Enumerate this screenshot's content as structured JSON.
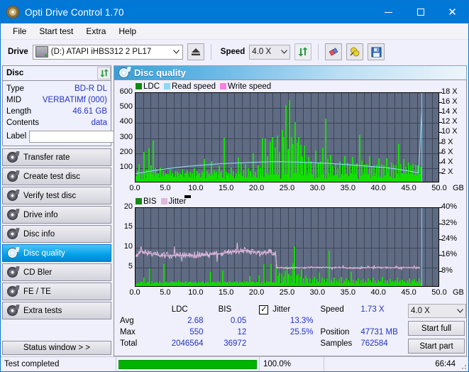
{
  "window": {
    "title": "Opti Drive Control 1.70",
    "icon": "disc-icon",
    "minimize": "—",
    "maximize": "□",
    "close": "✕"
  },
  "menu": {
    "items": [
      "File",
      "Start test",
      "Extra",
      "Help"
    ]
  },
  "toolbar": {
    "drive_label": "Drive",
    "drive_value": "(D:)   ATAPI iHBS312  2 PL17",
    "eject_icon": "eject-icon",
    "speed_label": "Speed",
    "speed_value": "4.0 X",
    "refresh_icon": "refresh-icon",
    "eraser_icon": "eraser-icon",
    "bulb_icon": "bulb-icon",
    "save_icon": "save-icon",
    "caret": "∨"
  },
  "sidebar": {
    "disc_panel": {
      "title": "Disc",
      "refresh_icon": "refresh-icon",
      "rows": [
        {
          "key": "Type",
          "value": "BD-R DL"
        },
        {
          "key": "MID",
          "value": "VERBATIMf (000)"
        },
        {
          "key": "Length",
          "value": "46.61 GB"
        },
        {
          "key": "Contents",
          "value": "data"
        }
      ],
      "label_key": "Label",
      "label_value": "",
      "label_placeholder": "",
      "label_button_icon": "disc-icon"
    },
    "nav": [
      {
        "label": "Transfer rate",
        "icon": "disc-icon",
        "active": false
      },
      {
        "label": "Create test disc",
        "icon": "disc-icon",
        "active": false
      },
      {
        "label": "Verify test disc",
        "icon": "disc-icon",
        "active": false
      },
      {
        "label": "Drive info",
        "icon": "disc-icon",
        "active": false
      },
      {
        "label": "Disc info",
        "icon": "disc-icon",
        "active": false
      },
      {
        "label": "Disc quality",
        "icon": "disc-icon",
        "active": true
      },
      {
        "label": "CD Bler",
        "icon": "disc-icon",
        "active": false
      },
      {
        "label": "FE / TE",
        "icon": "disc-icon",
        "active": false
      },
      {
        "label": "Extra tests",
        "icon": "disc-icon",
        "active": false
      }
    ],
    "status_window_button": "Status window > >"
  },
  "main": {
    "header": {
      "title": "Disc quality",
      "icon": "disc-icon"
    }
  },
  "stats": {
    "col_headers": [
      "LDC",
      "BIS"
    ],
    "row_headers": [
      "Avg",
      "Max",
      "Total"
    ],
    "ldc": {
      "avg": "2.68",
      "max": "550",
      "total": "2046564"
    },
    "bis": {
      "avg": "0.05",
      "max": "12",
      "total": "36972"
    },
    "jitter": {
      "label": "Jitter",
      "checked": true,
      "check_glyph": "✓",
      "avg": "13.3%",
      "max": "25.5%"
    },
    "speed_label": "Speed",
    "speed_value": "1.73 X",
    "position_label": "Position",
    "position_value": "47731 MB",
    "samples_label": "Samples",
    "samples_value": "762584",
    "speed_select": "4.0 X",
    "start_full_button": "Start full",
    "start_part_button": "Start part"
  },
  "statusbar": {
    "message": "Test completed",
    "percent": "100.0%",
    "elapsed": "66:44",
    "progress_value": 100
  },
  "colors": {
    "accent": "#0078d7",
    "plot_bg": "#5f6b82",
    "ldc_green": "#12e000",
    "read_speed_blue": "#8fd8f5",
    "write_speed_pink": "#f97fe0",
    "bis_green": "#12d900",
    "jitter_pink": "#e2b6de",
    "value_blue": "#2431c7",
    "cursor_cyan": "#62d9f5"
  },
  "chart_data": [
    {
      "type": "bar",
      "name": "quality-chart",
      "title": "",
      "xlabel": "GB",
      "ylabel": "LDC",
      "xlim": [
        0,
        50
      ],
      "ylim": [
        0,
        600
      ],
      "y2lim": [
        0,
        18
      ],
      "y2label": "X",
      "grid": true,
      "legend": [
        {
          "label": "LDC",
          "color": "#108a10"
        },
        {
          "label": "Read speed",
          "color": "#8fd8f5"
        },
        {
          "label": "Write speed",
          "color": "#f97fe0"
        }
      ],
      "xticks": [
        "0.0",
        "5.0",
        "10.0",
        "15.0",
        "20.0",
        "25.0",
        "30.0",
        "35.0",
        "40.0",
        "45.0",
        "50.0"
      ],
      "yticks": [
        100,
        200,
        300,
        400,
        500,
        600
      ],
      "y2ticks": [
        "2 X",
        "4 X",
        "6 X",
        "8 X",
        "10 X",
        "12 X",
        "14 X",
        "16 X",
        "18 X"
      ],
      "cursor_x": 47.0,
      "series": [
        {
          "name": "LDC",
          "type": "bar",
          "color": "#12e000",
          "x": [
            0.2,
            0.5,
            0.9,
            1.3,
            1.7,
            2.1,
            2.4,
            2.8,
            3.2,
            3.6,
            4.0,
            4.4,
            4.8,
            5.2,
            5.6,
            6.0,
            6.4,
            6.8,
            7.2,
            7.6,
            8.0,
            8.4,
            8.8,
            9.2,
            9.6,
            10.0,
            10.4,
            10.8,
            11.2,
            11.6,
            12.0,
            12.4,
            12.8,
            13.2,
            13.6,
            14.0,
            14.4,
            14.8,
            15.2,
            15.6,
            16.0,
            16.4,
            16.8,
            17.2,
            17.6,
            18.0,
            18.4,
            18.8,
            19.2,
            19.6,
            20.0,
            20.4,
            20.8,
            21.2,
            21.6,
            22.0,
            22.4,
            22.8,
            23.2,
            23.6,
            24.0,
            24.3,
            24.6,
            24.9,
            25.2,
            25.5,
            25.8,
            26.1,
            26.4,
            26.7,
            27.0,
            27.3,
            27.6,
            27.9,
            28.3,
            28.7,
            29.1,
            29.5,
            29.9,
            30.3,
            30.7,
            31.1,
            31.5,
            31.9,
            32.3,
            32.7,
            33.1,
            33.5,
            33.9,
            34.3,
            34.7,
            35.1,
            35.5,
            35.9,
            36.3,
            36.7,
            37.1,
            37.5,
            37.9,
            38.3,
            38.7,
            39.1,
            39.5,
            39.9,
            40.3,
            40.7,
            41.1,
            41.5,
            41.9,
            42.3,
            42.7,
            43.1,
            43.5,
            43.9,
            44.3,
            44.7,
            45.1,
            45.5,
            45.9,
            46.3,
            46.7
          ],
          "y": [
            70,
            120,
            60,
            200,
            80,
            225,
            110,
            275,
            90,
            60,
            95,
            70,
            60,
            55,
            85,
            60,
            70,
            65,
            60,
            85,
            60,
            75,
            65,
            55,
            90,
            70,
            60,
            65,
            150,
            70,
            60,
            140,
            75,
            65,
            110,
            70,
            295,
            65,
            60,
            95,
            70,
            60,
            160,
            130,
            75,
            120,
            90,
            70,
            190,
            65,
            110,
            90,
            290,
            290,
            170,
            265,
            300,
            230,
            310,
            200,
            345,
            300,
            510,
            220,
            545,
            300,
            250,
            400,
            260,
            300,
            245,
            170,
            240,
            135,
            165,
            140,
            120,
            210,
            130,
            140,
            230,
            420,
            150,
            180,
            110,
            125,
            90,
            140,
            115,
            170,
            130,
            120,
            165,
            110,
            125,
            315,
            145,
            115,
            120,
            170,
            100,
            110,
            115,
            155,
            120,
            110,
            155,
            100,
            130,
            115,
            110,
            250,
            120,
            150,
            100,
            130,
            110,
            120,
            115,
            110,
            100
          ]
        },
        {
          "name": "Read speed",
          "type": "line",
          "color": "#8fd8f5",
          "x": [
            0.0,
            2.0,
            4.0,
            6.0,
            8.0,
            10.0,
            12.0,
            14.0,
            16.0,
            18.0,
            20.0,
            22.0,
            23.5,
            25.0,
            27.0,
            29.0,
            31.0,
            33.0,
            35.0,
            37.0,
            39.0,
            41.0,
            43.0,
            45.0,
            46.5,
            47.0
          ],
          "y_x_units": [
            1.9,
            2.3,
            2.7,
            3.0,
            3.3,
            3.5,
            3.7,
            3.9,
            4.0,
            4.1,
            4.2,
            4.25,
            4.3,
            4.25,
            4.2,
            4.1,
            4.0,
            3.85,
            3.7,
            3.5,
            3.3,
            3.1,
            2.8,
            2.4,
            2.05,
            14.0
          ]
        }
      ]
    },
    {
      "type": "bar",
      "name": "bis-jitter-chart",
      "title": "",
      "xlabel": "GB",
      "ylabel": "BIS",
      "xlim": [
        0,
        50
      ],
      "ylim": [
        0,
        20
      ],
      "y2lim": [
        0,
        40
      ],
      "y2label": "%",
      "grid": true,
      "legend": [
        {
          "label": "BIS",
          "color": "#108a10"
        },
        {
          "label": "Jitter",
          "color": "#e2b6de"
        }
      ],
      "xticks": [
        "0.0",
        "5.0",
        "10.0",
        "15.0",
        "20.0",
        "25.0",
        "30.0",
        "35.0",
        "40.0",
        "45.0",
        "50.0"
      ],
      "yticks": [
        5,
        10,
        15,
        20
      ],
      "y2ticks": [
        "8%",
        "16%",
        "24%",
        "32%",
        "40%"
      ],
      "cursor_x": 47.0,
      "series": [
        {
          "name": "BIS",
          "type": "bar",
          "color": "#12d900",
          "x": [
            0.3,
            0.8,
            1.3,
            1.8,
            2.2,
            2.6,
            3.0,
            3.4,
            3.8,
            4.2,
            4.6,
            5.0,
            5.4,
            5.8,
            6.2,
            6.6,
            7.0,
            7.4,
            7.8,
            8.2,
            8.6,
            9.0,
            9.4,
            9.8,
            10.2,
            10.6,
            11.0,
            11.4,
            11.8,
            12.2,
            12.6,
            13.0,
            13.4,
            13.8,
            14.2,
            14.6,
            15.0,
            15.4,
            15.8,
            16.2,
            16.6,
            17.0,
            17.4,
            17.8,
            18.2,
            18.6,
            19.0,
            19.4,
            19.8,
            20.2,
            20.6,
            21.0,
            21.4,
            21.8,
            22.2,
            22.6,
            23.0,
            23.3,
            23.6,
            23.9,
            24.2,
            24.5,
            24.8,
            25.1,
            25.4,
            25.7,
            26.0,
            26.3,
            26.6,
            26.9,
            27.2,
            27.5,
            27.8,
            28.1,
            28.5,
            28.9,
            29.3,
            29.7,
            30.1,
            30.5,
            30.9,
            31.3,
            31.7,
            32.1,
            32.5,
            32.9,
            33.3,
            33.7,
            34.1,
            34.5,
            34.9,
            35.3,
            35.7,
            36.1,
            36.5,
            36.9,
            37.3,
            37.7,
            38.1,
            38.5,
            38.9,
            39.3,
            39.7,
            40.1,
            40.5,
            40.9,
            41.3,
            41.7,
            42.1,
            42.5,
            42.9,
            43.3,
            43.7,
            44.1,
            44.5,
            44.9,
            45.3,
            45.7,
            46.1,
            46.5,
            46.8
          ],
          "y": [
            0.8,
            1.0,
            2.2,
            0.9,
            4.5,
            1.2,
            0.9,
            1.0,
            1.2,
            0.9,
            5.5,
            1.0,
            0.9,
            1.2,
            1.0,
            0.9,
            1.4,
            1.0,
            0.9,
            1.2,
            1.0,
            1.1,
            0.9,
            1.3,
            1.0,
            0.9,
            1.2,
            1.0,
            1.1,
            3.5,
            1.0,
            0.9,
            1.2,
            1.0,
            3.9,
            1.1,
            1.0,
            1.2,
            0.9,
            1.0,
            1.3,
            1.0,
            1.1,
            1.0,
            1.2,
            2.5,
            1.0,
            1.1,
            1.0,
            2.6,
            1.0,
            5.5,
            1.2,
            1.0,
            5.6,
            1.1,
            5.5,
            2.6,
            3.4,
            3.1,
            2.4,
            4.0,
            5.0,
            3.1,
            2.6,
            5.8,
            10.0,
            2.7,
            3.0,
            2.4,
            4.2,
            2.0,
            2.7,
            1.9,
            2.0,
            1.6,
            2.3,
            1.8,
            3.4,
            2.2,
            1.7,
            2.0,
            9.0,
            1.6,
            2.1,
            1.5,
            1.8,
            2.3,
            1.5,
            1.9,
            1.4,
            3.6,
            1.6,
            1.4,
            2.0,
            1.5,
            1.7,
            1.4,
            1.9,
            1.5,
            2.1,
            1.4,
            1.6,
            1.3,
            2.4,
            1.5,
            1.4,
            1.8,
            1.3,
            1.5,
            2.2,
            1.4,
            1.6,
            1.3,
            1.5,
            1.9,
            1.4,
            1.7,
            1.3,
            2.0,
            1.5
          ]
        },
        {
          "name": "Jitter",
          "type": "line",
          "color": "#e2b6de",
          "x": [
            0.0,
            1.0,
            2.0,
            3.0,
            4.0,
            5.0,
            6.0,
            7.0,
            8.0,
            9.0,
            10.0,
            11.0,
            12.0,
            13.0,
            14.0,
            15.0,
            16.0,
            17.0,
            18.0,
            19.0,
            20.0,
            21.0,
            22.0,
            23.0,
            23.2,
            24.0,
            25.0,
            26.0,
            27.0,
            28.0,
            29.0,
            30.0,
            31.0,
            32.0,
            33.0,
            34.0,
            35.0,
            36.0,
            37.0,
            38.0,
            39.0,
            40.0,
            41.0,
            42.0,
            43.0,
            44.0,
            45.0,
            46.0,
            46.8
          ],
          "y": [
            8.0,
            9.2,
            8.6,
            8.4,
            8.1,
            8.0,
            8.0,
            8.1,
            8.1,
            8.0,
            8.0,
            8.1,
            8.2,
            8.4,
            8.5,
            8.8,
            9.0,
            9.0,
            9.3,
            9.0,
            8.9,
            8.9,
            8.9,
            8.6,
            5.0,
            5.0,
            4.9,
            5.0,
            5.0,
            5.0,
            5.1,
            5.0,
            5.1,
            5.0,
            5.0,
            5.0,
            4.9,
            4.9,
            4.9,
            5.0,
            5.0,
            5.0,
            5.0,
            5.0,
            5.0,
            5.0,
            5.0,
            5.0,
            5.0
          ]
        }
      ]
    }
  ]
}
